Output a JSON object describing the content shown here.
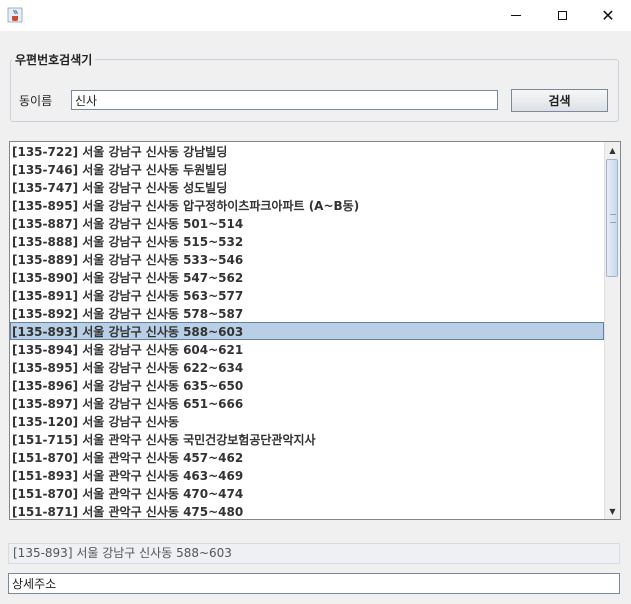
{
  "titlebar": {
    "icon": "java-coffee-icon",
    "minimize_glyph": "",
    "maximize_glyph": "",
    "close_glyph": "✕"
  },
  "search_group": {
    "title": "우편번호검색기",
    "dong_label": "동이름",
    "dong_value": "신사",
    "search_button": "검색"
  },
  "results": {
    "items": [
      "[135-722] 서울 강남구 신사동 강남빌딩",
      "[135-746] 서울 강남구 신사동 두원빌딩",
      "[135-747] 서울 강남구 신사동 성도빌딩",
      "[135-895] 서울 강남구 신사동 압구정하이츠파크아파트 (A~B동)",
      "[135-887] 서울 강남구 신사동  501~514",
      "[135-888] 서울 강남구 신사동  515~532",
      "[135-889] 서울 강남구 신사동  533~546",
      "[135-890] 서울 강남구 신사동  547~562",
      "[135-891] 서울 강남구 신사동  563~577",
      "[135-892] 서울 강남구 신사동  578~587",
      "[135-893] 서울 강남구 신사동  588~603",
      "[135-894] 서울 강남구 신사동  604~621",
      "[135-895] 서울 강남구 신사동  622~634",
      "[135-896] 서울 강남구 신사동  635~650",
      "[135-897] 서울 강남구 신사동  651~666",
      "[135-120] 서울 강남구 신사동",
      "[151-715] 서울 관악구 신사동 국민건강보험공단관악지사",
      "[151-870] 서울 관악구 신사동  457~462",
      "[151-893] 서울 관악구 신사동  463~469",
      "[151-870] 서울 관악구 신사동  470~474",
      "[151-871] 서울 관악구 신사동  475~480"
    ],
    "selected_index": 10
  },
  "selected_address": "[135-893] 서울 강남구 신사동  588~603",
  "detail": {
    "placeholder_value": "상세주소"
  },
  "colors": {
    "selection_bg": "#b8cfe5",
    "selection_border": "#6382a8"
  }
}
